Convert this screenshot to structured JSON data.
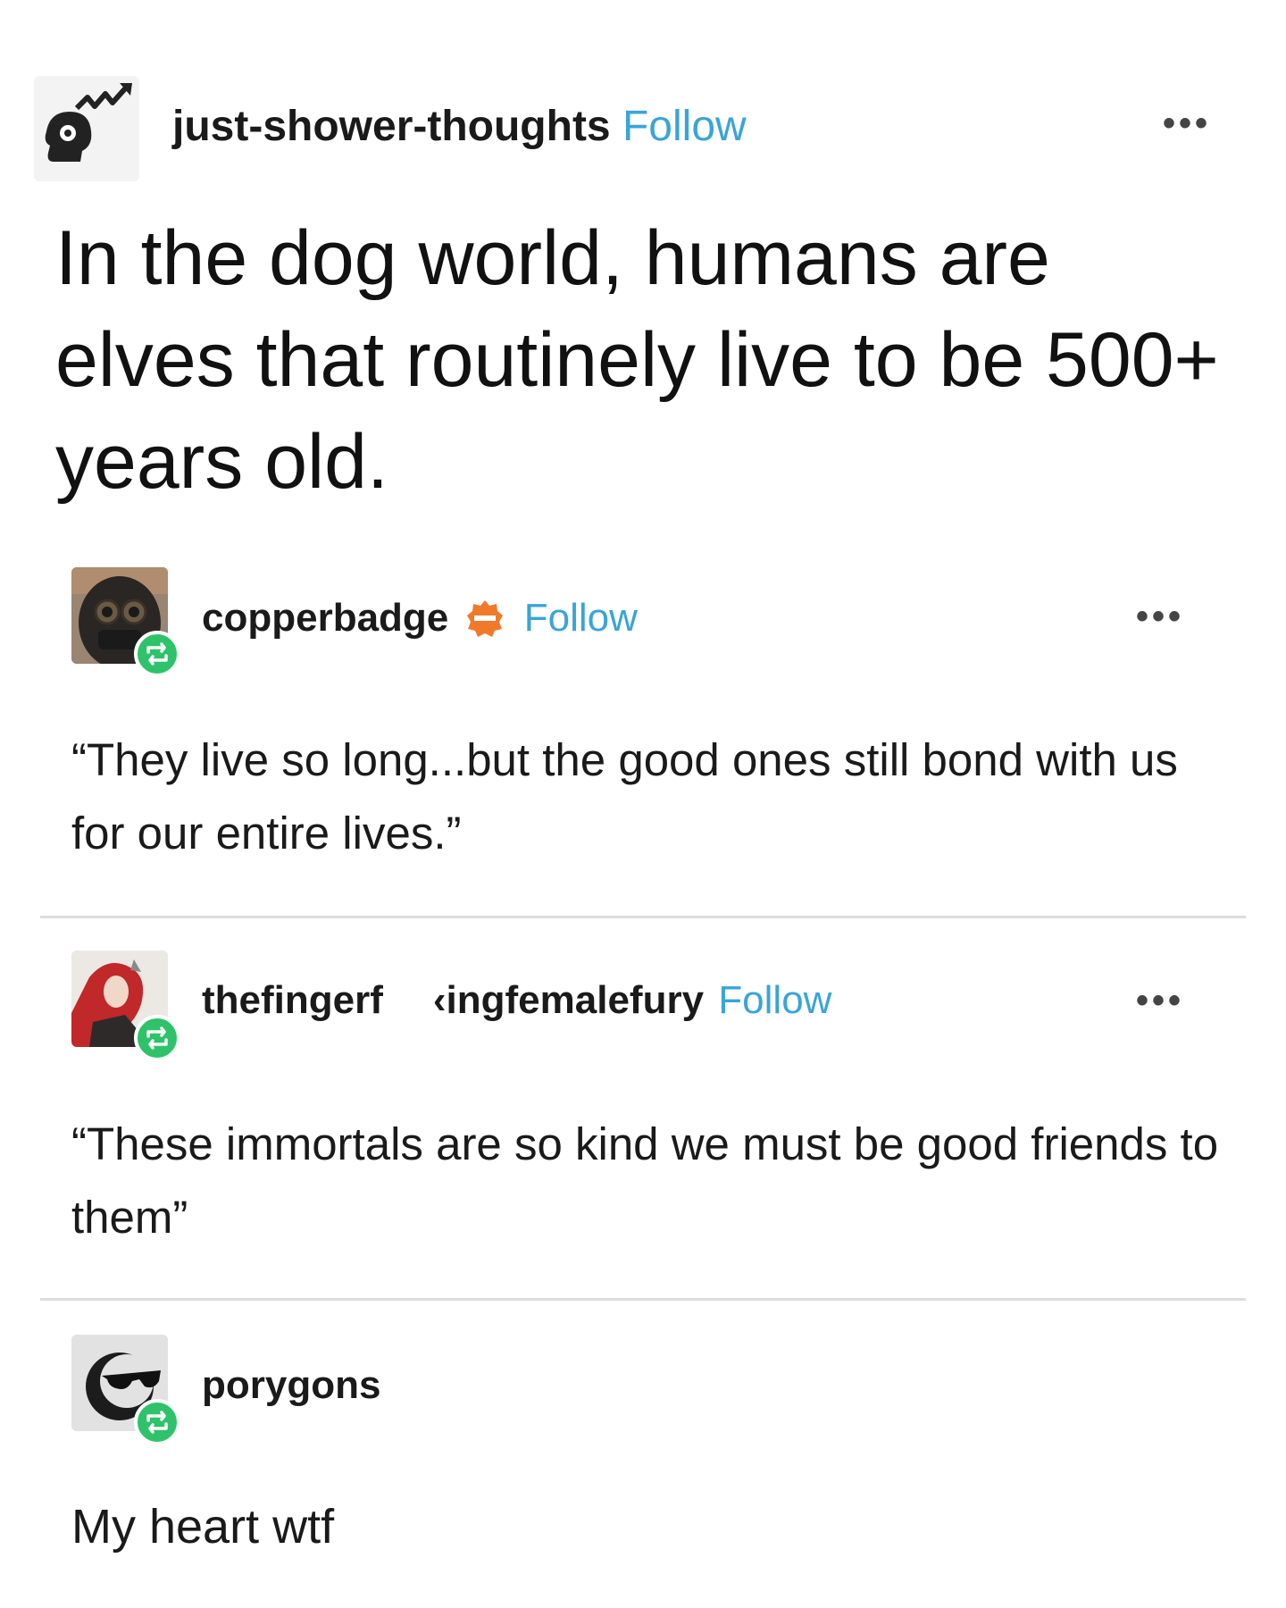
{
  "post": {
    "author": "just-shower-thoughts",
    "follow_label": "Follow",
    "more_label": "•••",
    "text": "In the dog world, humans are elves that routinely live to be 500+ years old."
  },
  "reblogs": [
    {
      "author": "copperbadge",
      "follow_label": "Follow",
      "more_label": "•••",
      "text": "“They live so long...but the good ones still bond with us for our entire lives.”",
      "badge_icon": "verified-badge-icon"
    },
    {
      "author_part1": "thefingerf",
      "author_part2": "‹ingfemalefury",
      "follow_label": "Follow",
      "more_label": "•••",
      "text": "“These immortals are so kind we must be good friends to them”"
    },
    {
      "author": "porygons",
      "text": "My heart wtf"
    }
  ],
  "colors": {
    "follow": "#3aa4d8",
    "reblog_badge": "#2ec26a",
    "divider": "#dcdcdc",
    "verified_badge": "#f07a2a"
  }
}
